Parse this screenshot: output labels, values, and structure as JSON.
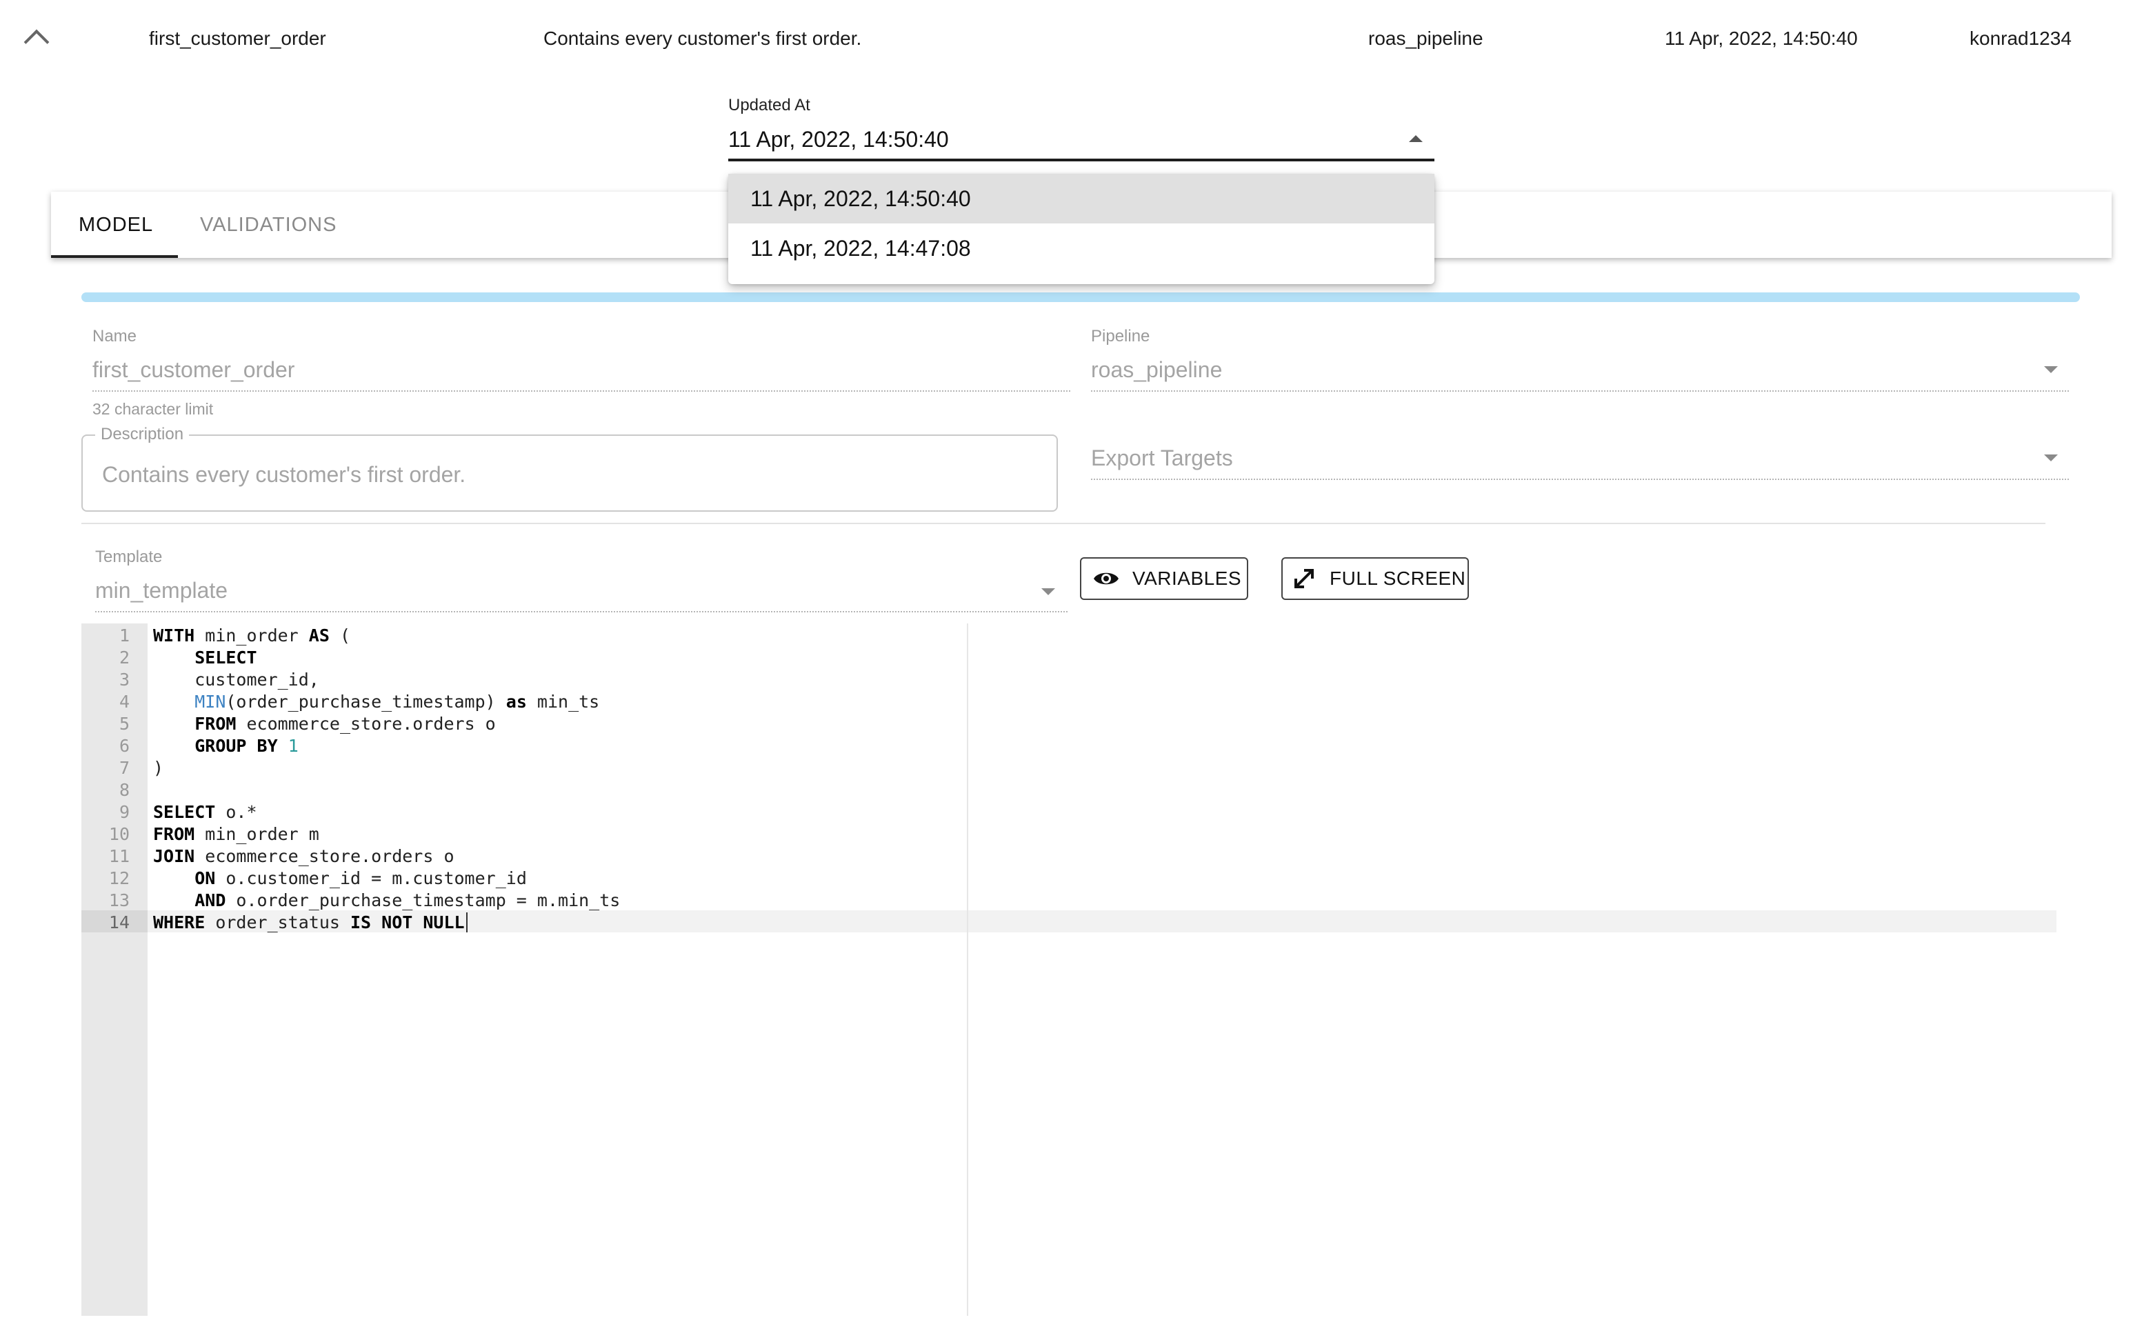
{
  "summary_row": {
    "name": "first_customer_order",
    "description": "Contains every customer's first order.",
    "pipeline": "roas_pipeline",
    "updated_at": "11 Apr, 2022, 14:50:40",
    "author": "konrad1234"
  },
  "updated_at_select": {
    "label": "Updated At",
    "value": "11 Apr, 2022, 14:50:40",
    "options": [
      "11 Apr, 2022, 14:50:40",
      "11 Apr, 2022, 14:47:08"
    ]
  },
  "tabs": [
    {
      "label": "MODEL",
      "active": true
    },
    {
      "label": "VALIDATIONS",
      "active": false
    }
  ],
  "form": {
    "name_label": "Name",
    "name_value": "first_customer_order",
    "name_helper": "32 character limit",
    "pipeline_label": "Pipeline",
    "pipeline_value": "roas_pipeline",
    "description_label": "Description",
    "description_placeholder": "Contains every customer's first order.",
    "export_targets_placeholder": "Export Targets",
    "template_label": "Template",
    "template_value": "min_template"
  },
  "buttons": {
    "variables": "VARIABLES",
    "full_screen": "FULL SCREEN"
  },
  "editor": {
    "line_numbers": [
      "1",
      "2",
      "3",
      "4",
      "5",
      "6",
      "7",
      "8",
      "9",
      "10",
      "11",
      "12",
      "13",
      "14"
    ],
    "active_line": 14,
    "lines": [
      [
        {
          "t": "WITH",
          "c": "kw"
        },
        {
          "t": " min_order "
        },
        {
          "t": "AS",
          "c": "kw"
        },
        {
          "t": " ("
        }
      ],
      [
        {
          "t": "    "
        },
        {
          "t": "SELECT",
          "c": "kw"
        }
      ],
      [
        {
          "t": "    customer_id,"
        }
      ],
      [
        {
          "t": "    "
        },
        {
          "t": "MIN",
          "c": "fn"
        },
        {
          "t": "(order_purchase_timestamp) "
        },
        {
          "t": "as",
          "c": "kw"
        },
        {
          "t": " min_ts"
        }
      ],
      [
        {
          "t": "    "
        },
        {
          "t": "FROM",
          "c": "kw"
        },
        {
          "t": " ecommerce_store.orders o"
        }
      ],
      [
        {
          "t": "    "
        },
        {
          "t": "GROUP BY",
          "c": "kw"
        },
        {
          "t": " "
        },
        {
          "t": "1",
          "c": "num"
        }
      ],
      [
        {
          "t": ")"
        }
      ],
      [],
      [
        {
          "t": "SELECT",
          "c": "kw"
        },
        {
          "t": " o.*"
        }
      ],
      [
        {
          "t": "FROM",
          "c": "kw"
        },
        {
          "t": " min_order m"
        }
      ],
      [
        {
          "t": "JOIN",
          "c": "kw"
        },
        {
          "t": " ecommerce_store.orders o"
        }
      ],
      [
        {
          "t": "    "
        },
        {
          "t": "ON",
          "c": "kw"
        },
        {
          "t": " o.customer_id = m.customer_id"
        }
      ],
      [
        {
          "t": "    "
        },
        {
          "t": "AND",
          "c": "kw"
        },
        {
          "t": " o.order_purchase_timestamp = m.min_ts"
        }
      ],
      [
        {
          "t": "WHERE",
          "c": "kw"
        },
        {
          "t": " order_status "
        },
        {
          "t": "IS NOT NULL",
          "c": "kw"
        }
      ]
    ]
  },
  "icons": {
    "collapse": "chevron-up-icon",
    "select_caret": "caret-up-icon",
    "dropdown_caret": "caret-down-icon",
    "variables": "eye-icon",
    "full_screen": "expand-icon"
  },
  "colors": {
    "progress": "#b3e0f7",
    "selected_option": "#e0e0e0",
    "function": "#3d82c2",
    "number": "#2a9a9a"
  }
}
